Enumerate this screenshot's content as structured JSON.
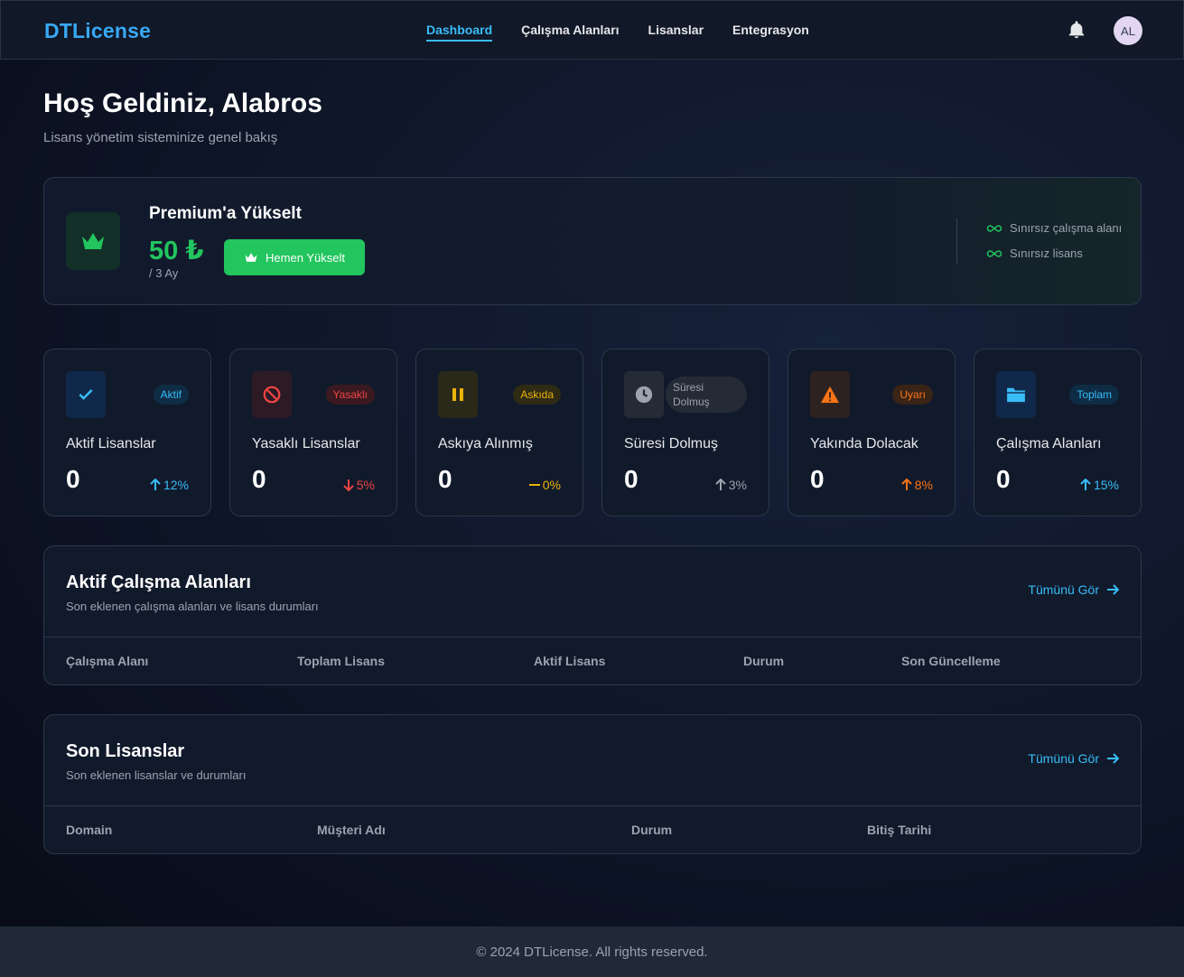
{
  "nav": {
    "brand": "DTLicense",
    "links": [
      "Dashboard",
      "Çalışma Alanları",
      "Lisanslar",
      "Entegrasyon"
    ],
    "avatar_initials": "AL",
    "bell_icon": "bell-icon"
  },
  "header": {
    "title": "Hoş Geldiniz, Alabros",
    "subtitle": "Lisans yönetim sisteminize genel bakış"
  },
  "premium": {
    "title": "Premium'a Yükselt",
    "price": "50 ₺",
    "period": "/ 3 Ay",
    "button_label": "Hemen Yükselt",
    "features": [
      "Sınırsız çalışma alanı",
      "Sınırsız lisans"
    ],
    "accent": "#22c55e"
  },
  "stats": [
    {
      "label": "Aktif Lisanslar",
      "badge": "Aktif",
      "value": "0",
      "trend": "12%",
      "trend_dir": "up",
      "color": "#38bdf8",
      "icon": "check-icon"
    },
    {
      "label": "Yasaklı Lisanslar",
      "badge": "Yasaklı",
      "value": "0",
      "trend": "5%",
      "trend_dir": "down",
      "color": "#ef4444",
      "icon": "ban-icon"
    },
    {
      "label": "Askıya Alınmış",
      "badge": "Askıda",
      "value": "0",
      "trend": "0%",
      "trend_dir": "flat",
      "color": "#eab308",
      "icon": "pause-icon"
    },
    {
      "label": "Süresi Dolmuş",
      "badge": "Süresi Dolmuş",
      "value": "0",
      "trend": "3%",
      "trend_dir": "up",
      "color": "#9ca3af",
      "icon": "clock-icon"
    },
    {
      "label": "Yakında Dolacak",
      "badge": "Uyarı",
      "value": "0",
      "trend": "8%",
      "trend_dir": "up",
      "color": "#f97316",
      "icon": "warning-icon"
    },
    {
      "label": "Çalışma Alanları",
      "badge": "Toplam",
      "value": "0",
      "trend": "15%",
      "trend_dir": "up",
      "color": "#38bdf8",
      "icon": "folder-icon"
    }
  ],
  "workspaces": {
    "title": "Aktif Çalışma Alanları",
    "subtitle": "Son eklenen çalışma alanları ve lisans durumları",
    "link": "Tümünü Gör",
    "columns": [
      "Çalışma Alanı",
      "Toplam Lisans",
      "Aktif Lisans",
      "Durum",
      "Son Güncelleme"
    ]
  },
  "licenses": {
    "title": "Son Lisanslar",
    "subtitle": "Son eklenen lisanslar ve durumları",
    "link": "Tümünü Gör",
    "columns": [
      "Domain",
      "Müşteri Adı",
      "Durum",
      "Bitiş Tarihi"
    ]
  },
  "footer": {
    "text": "© 2024 DTLicense. All rights reserved."
  }
}
